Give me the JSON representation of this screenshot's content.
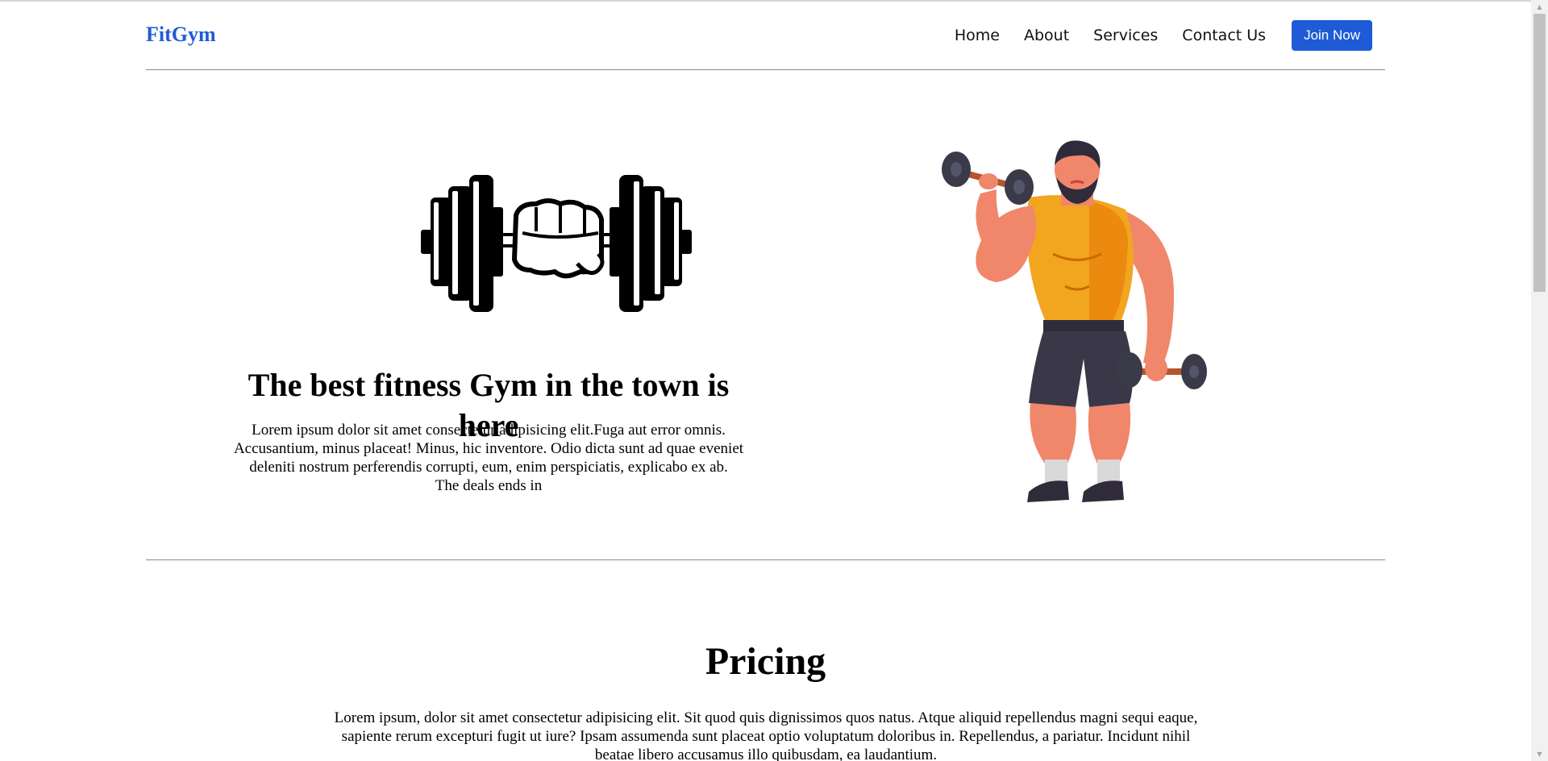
{
  "nav": {
    "logo": "FitGym",
    "links": [
      "Home",
      "About",
      "Services",
      "Contact Us"
    ],
    "cta_label": "Join Now"
  },
  "hero": {
    "title": "The best fitness Gym in the town is here",
    "text": "Lorem ipsum dolor sit amet consectetur adipisicing elit.Fuga aut error omnis. Accusantium, minus placeat! Minus, hic inventore. Odio dicta sunt ad quae eveniet deleniti nostrum perferendis corrupti, eum, enim perspiciatis, explicabo ex ab.",
    "deal_text": "The deals ends in",
    "dumbbell_icon": "dumbbell-fist-icon",
    "illustration": "muscular-man-with-dumbbells"
  },
  "pricing": {
    "title": "Pricing",
    "text": "Lorem ipsum, dolor sit amet consectetur adipisicing elit. Sit quod quis dignissimos quos natus. Atque aliquid repellendus magni sequi eaque, sapiente rerum excepturi fugit ut iure? Ipsam assumenda sunt placeat optio voluptatum doloribus in. Repellendus, a pariatur. Incidunt nihil beatae libero accusamus illo quibusdam, ea laudantium."
  },
  "colors": {
    "brand": "#1f5bd6",
    "divider": "#8c8c8c",
    "text": "#000000"
  }
}
